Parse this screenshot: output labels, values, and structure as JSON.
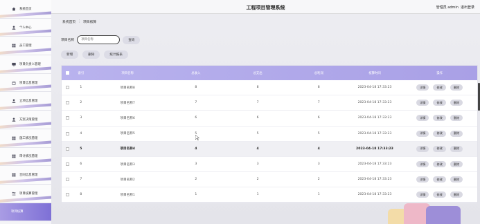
{
  "app": {
    "title": "工程项目管理系统"
  },
  "user": {
    "greeting": "管理员 admin",
    "logout": "退出登录"
  },
  "sidebar": {
    "items": [
      {
        "label": "系统首页",
        "icon": "home-icon"
      },
      {
        "label": "个人中心",
        "icon": "person-icon"
      },
      {
        "label": "员工管理",
        "icon": "grid-icon"
      },
      {
        "label": "项目负责人管理",
        "icon": "monitor-icon"
      },
      {
        "label": "项目信息管理",
        "icon": "calendar-icon"
      },
      {
        "label": "立项信息管理",
        "icon": "person-icon"
      },
      {
        "label": "方案决策管理",
        "icon": "person-icon"
      },
      {
        "label": "施工情况管理",
        "icon": "grid-icon"
      },
      {
        "label": "审计情况管理",
        "icon": "grid-icon"
      },
      {
        "label": "合同信息管理",
        "icon": "grid-icon"
      },
      {
        "label": "项目核算管理",
        "icon": "sliders-icon"
      },
      {
        "label": "项目核算",
        "icon": ""
      }
    ],
    "active_index": 11
  },
  "breadcrumb": {
    "home": "系统首页",
    "separator": "⋮",
    "current": "项目核算"
  },
  "search": {
    "label": "项目名称",
    "placeholder": "项目名称",
    "button": "查询"
  },
  "actions": {
    "add": "新增",
    "delete": "删除",
    "report": "统计报表"
  },
  "table": {
    "headers": [
      "索引",
      "项目名称",
      "总收入",
      "总支出",
      "总利润",
      "核算时间",
      "操作"
    ],
    "row_actions": [
      "详情",
      "修改",
      "删除"
    ],
    "rows": [
      {
        "index": "1",
        "name": "项目名称8",
        "income": "8",
        "expense": "8",
        "profit": "8",
        "time": "2023-04-18 17:33:23"
      },
      {
        "index": "2",
        "name": "项目名称7",
        "income": "7",
        "expense": "7",
        "profit": "7",
        "time": "2023-04-18 17:33:23"
      },
      {
        "index": "3",
        "name": "项目名称6",
        "income": "6",
        "expense": "6",
        "profit": "6",
        "time": "2023-04-18 17:33:23"
      },
      {
        "index": "4",
        "name": "项目名称5",
        "income": "5",
        "expense": "5",
        "profit": "5",
        "time": "2023-04-18 17:33:23"
      },
      {
        "index": "5",
        "name": "项目名称4",
        "income": "4",
        "expense": "4",
        "profit": "4",
        "time": "2023-04-18 17:33:23"
      },
      {
        "index": "6",
        "name": "项目名称3",
        "income": "3",
        "expense": "3",
        "profit": "3",
        "time": "2023-04-18 17:33:23"
      },
      {
        "index": "7",
        "name": "项目名称2",
        "income": "2",
        "expense": "2",
        "profit": "2",
        "time": "2023-04-18 17:33:23"
      },
      {
        "index": "8",
        "name": "项目名称1",
        "income": "1",
        "expense": "1",
        "profit": "1",
        "time": "2023-04-18 17:33:23"
      }
    ],
    "highlight_row": 4
  },
  "colors": {
    "accent": "#a99ce4",
    "header": "#b9b3ee"
  }
}
